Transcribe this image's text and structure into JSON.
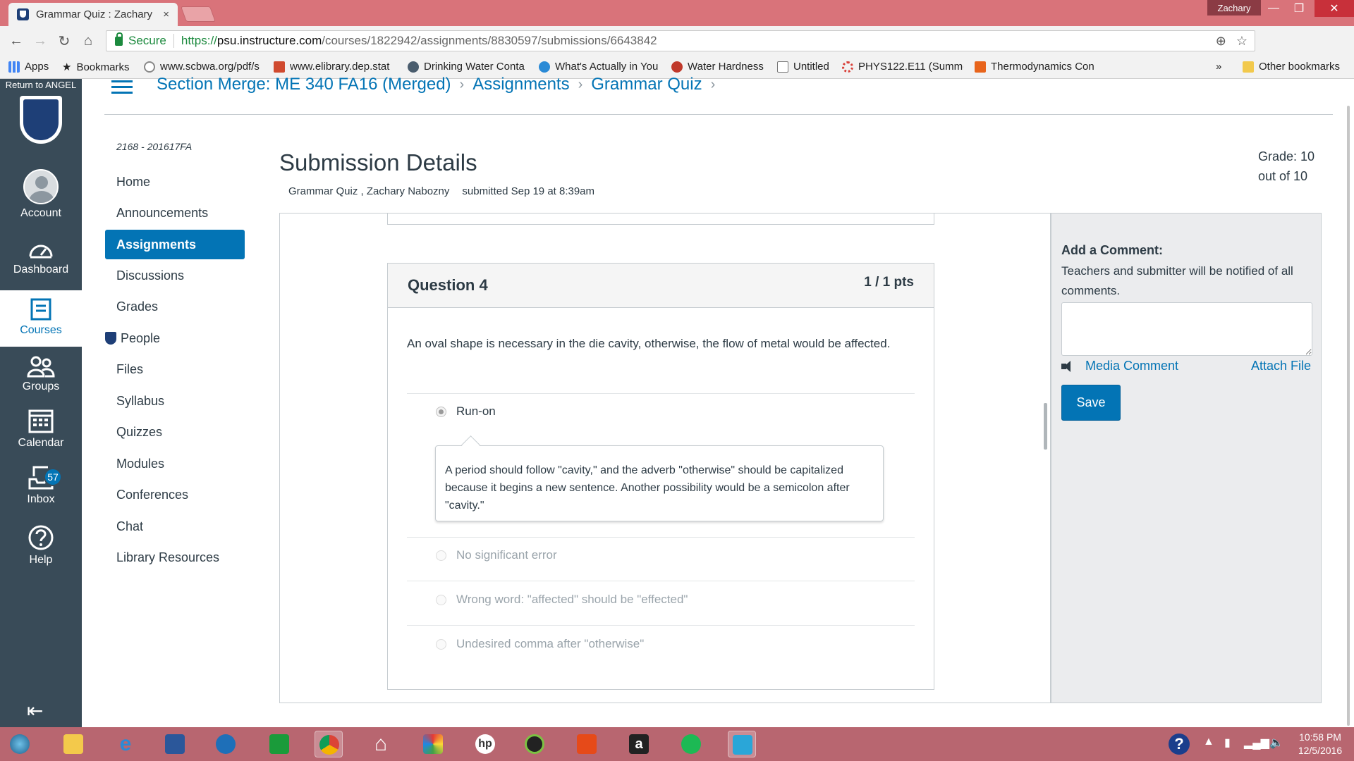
{
  "browser": {
    "tab_title": "Grammar Quiz : Zachary",
    "tab_close": "×",
    "user_name": "Zachary",
    "win_min": "—",
    "win_restore": "❐",
    "win_close": "✕",
    "secure_label": "Secure",
    "url_scheme": "https://",
    "url_host": "psu.instructure.com",
    "url_path": "/courses/1822942/assignments/8830597/submissions/6643842"
  },
  "bookmarks": {
    "apps": "Apps",
    "bookmarks": "Bookmarks",
    "items": [
      "www.scbwa.org/pdf/s",
      "www.elibrary.dep.stat",
      "Drinking Water Conta",
      "What's Actually in You",
      "Water Hardness",
      "Untitled",
      "PHYS122.E11 (Summe",
      "Thermodynamics Con"
    ],
    "more": "»",
    "other": "Other bookmarks"
  },
  "global_nav": {
    "return_label": "Return to ANGEL",
    "account": "Account",
    "dashboard": "Dashboard",
    "courses": "Courses",
    "groups": "Groups",
    "calendar": "Calendar",
    "inbox": "Inbox",
    "inbox_count": "57",
    "help": "Help"
  },
  "breadcrumb": {
    "course": "Section Merge: ME 340 FA16 (Merged)",
    "assignments": "Assignments",
    "quiz": "Grammar Quiz",
    "separator": "›"
  },
  "course_nav": {
    "term": "2168 - 201617FA",
    "items": [
      "Home",
      "Announcements",
      "Assignments",
      "Discussions",
      "Grades",
      "People",
      "Files",
      "Syllabus",
      "Quizzes",
      "Modules",
      "Conferences",
      "Chat",
      "Library Resources"
    ],
    "active_index": 2
  },
  "submission": {
    "title": "Submission Details",
    "quiz_name": "Grammar Quiz , Zachary Nabozny",
    "submitted": "submitted Sep 19 at 8:39am",
    "grade_line1": "Grade: 10",
    "grade_line2": "out of 10"
  },
  "question": {
    "name": "Question 4",
    "points": "1 / 1 pts",
    "text": "An oval shape is necessary in the die cavity, otherwise, the flow of metal would be affected.",
    "answers": [
      {
        "label": "Run-on",
        "selected": true
      },
      {
        "label": "No significant error",
        "selected": false
      },
      {
        "label": "Wrong word: \"affected\" should be \"effected\"",
        "selected": false
      },
      {
        "label": "Undesired comma after \"otherwise\"",
        "selected": false
      }
    ],
    "feedback": "A period should follow \"cavity,\" and the adverb \"otherwise\" should be capitalized because it begins a new sentence. Another possibility would be a semicolon after \"cavity.\""
  },
  "comments": {
    "heading": "Add a Comment:",
    "note": "Teachers and submitter will be notified of all comments.",
    "media": "Media Comment",
    "attach": "Attach File",
    "save": "Save"
  },
  "taskbar": {
    "time": "10:58 PM",
    "date": "12/5/2016",
    "help": "?"
  },
  "colors": {
    "canvas_blue": "#0374b5",
    "nav_bg": "#394b58",
    "chrome_frame": "#d9737a",
    "taskbar": "#b86670"
  }
}
